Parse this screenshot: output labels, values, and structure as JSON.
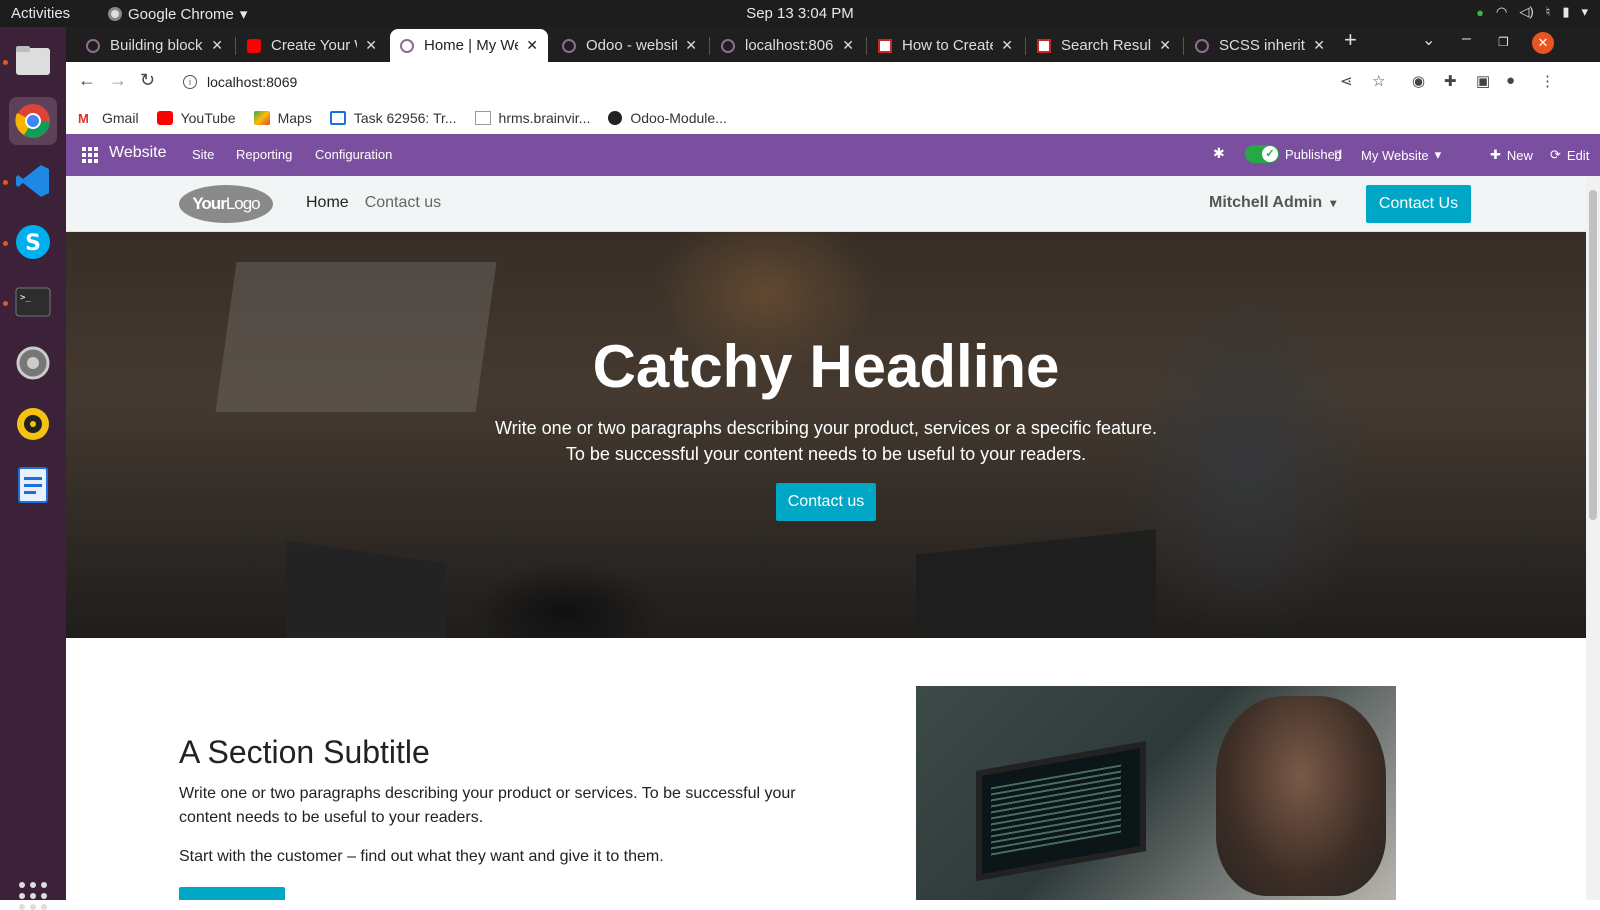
{
  "os": {
    "activities": "Activities",
    "app_name": "Google Chrome",
    "clock": "Sep 13  3:04 PM"
  },
  "tabs": [
    {
      "title": "Building block"
    },
    {
      "title": "Create Your W"
    },
    {
      "title": "Home | My We"
    },
    {
      "title": "Odoo - websit"
    },
    {
      "title": "localhost:806"
    },
    {
      "title": "How to Create"
    },
    {
      "title": "Search Result"
    },
    {
      "title": "SCSS inherita"
    }
  ],
  "address": {
    "url": "localhost:8069"
  },
  "bookmarks": [
    {
      "label": "Gmail"
    },
    {
      "label": "YouTube"
    },
    {
      "label": "Maps"
    },
    {
      "label": "Task 62956: Tr..."
    },
    {
      "label": "hrms.brainvir..."
    },
    {
      "label": "Odoo-Module..."
    }
  ],
  "odoo_bar": {
    "app": "Website",
    "menu": [
      "Site",
      "Reporting",
      "Configuration"
    ],
    "published": "Published",
    "my_website": "My Website",
    "new": "New",
    "edit": "Edit"
  },
  "site": {
    "logo_bold": "Your",
    "logo_light": "Logo",
    "nav": [
      "Home",
      "Contact us"
    ],
    "user": "Mitchell Admin",
    "header_cta": "Contact Us"
  },
  "hero": {
    "headline": "Catchy Headline",
    "line1": "Write one or two paragraphs describing your product, services or a specific feature.",
    "line2": "To be successful your content needs to be useful to your readers.",
    "cta": "Contact us"
  },
  "section": {
    "title": "A Section Subtitle",
    "para1": "Write one or two paragraphs describing your product or services. To be successful your content needs to be useful to your readers.",
    "para2": "Start with the customer – find out what they want and give it to them."
  },
  "colors": {
    "odoo_purple": "#7b4fa0",
    "accent": "#00a6c6",
    "dock": "#3b2238"
  }
}
